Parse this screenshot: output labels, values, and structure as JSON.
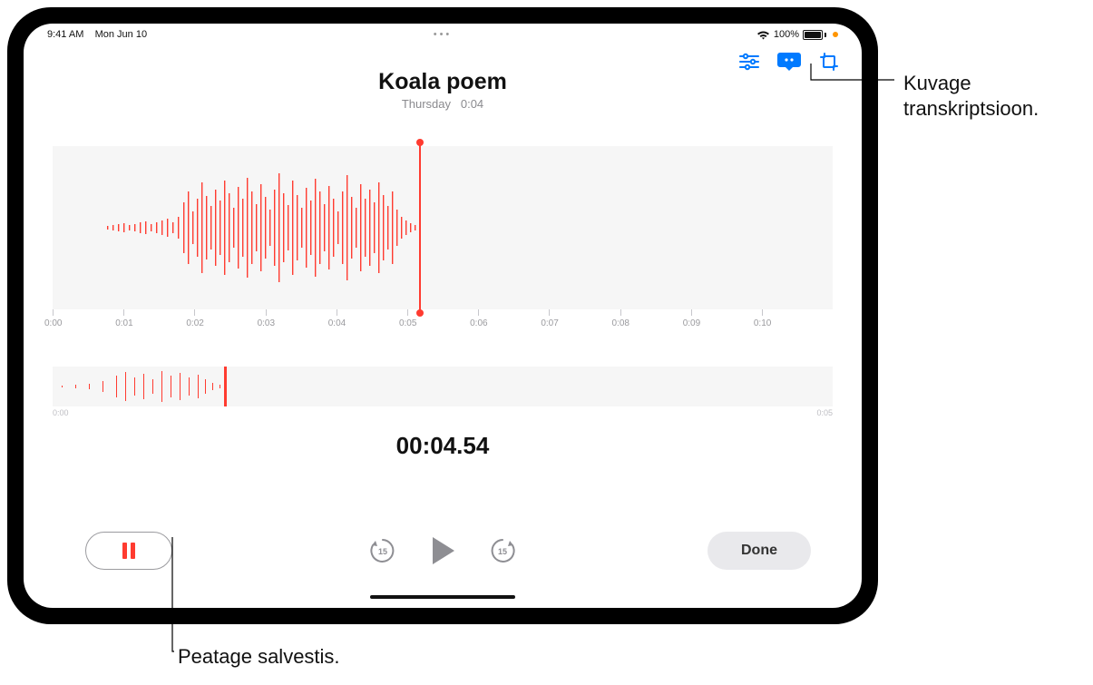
{
  "status": {
    "time": "9:41 AM",
    "date": "Mon Jun 10",
    "battery": "100%"
  },
  "colors": {
    "accent": "#ff3b30",
    "tint_active": "#007aff"
  },
  "recording": {
    "title": "Koala poem",
    "day": "Thursday",
    "duration": "0:04",
    "timeline_ticks": [
      "0:00",
      "0:01",
      "0:02",
      "0:03",
      "0:04",
      "0:05",
      "0:06",
      "0:07",
      "0:08",
      "0:09",
      "0:10"
    ],
    "mini_start": "0:00",
    "mini_end": "0:05",
    "timer": "00:04.54"
  },
  "toolbar": {
    "done_label": "Done"
  },
  "icons": {
    "options": "options-icon",
    "transcript": "transcript-icon",
    "trim": "trim-icon",
    "pause": "pause-icon",
    "skip_back": "skip-back-15-icon",
    "play": "play-icon",
    "skip_forward": "skip-forward-15-icon"
  },
  "callouts": {
    "transcript": "Kuvage transkriptsioon.",
    "pause": "Peatage salvestis."
  }
}
